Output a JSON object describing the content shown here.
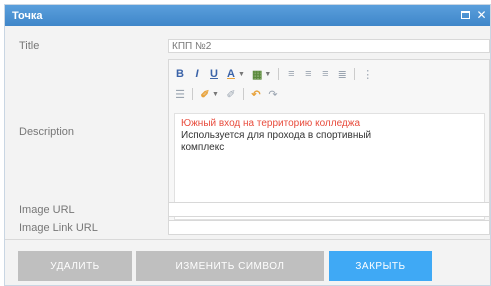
{
  "window": {
    "title": "Точка"
  },
  "form": {
    "title_label": "Title",
    "title_value": "КПП №2",
    "description_label": "Description",
    "description_lines": [
      "Южный вход на территорию колледжа",
      "Используется для прохода в спортивный",
      "комплекс"
    ],
    "image_url_label": "Image URL",
    "image_url_value": "",
    "image_link_url_label": "Image Link URL",
    "image_link_url_value": ""
  },
  "toolbar": {
    "bold": "B",
    "italic": "I",
    "underline": "U",
    "font_color": "A"
  },
  "buttons": {
    "delete": "УДАЛИТЬ",
    "change_symbol": "ИЗМЕНИТЬ СИМВОЛ",
    "close": "ЗАКРЫТЬ"
  },
  "colors": {
    "accent": "#3fa9f5",
    "description_highlight": "#e84c3d"
  }
}
